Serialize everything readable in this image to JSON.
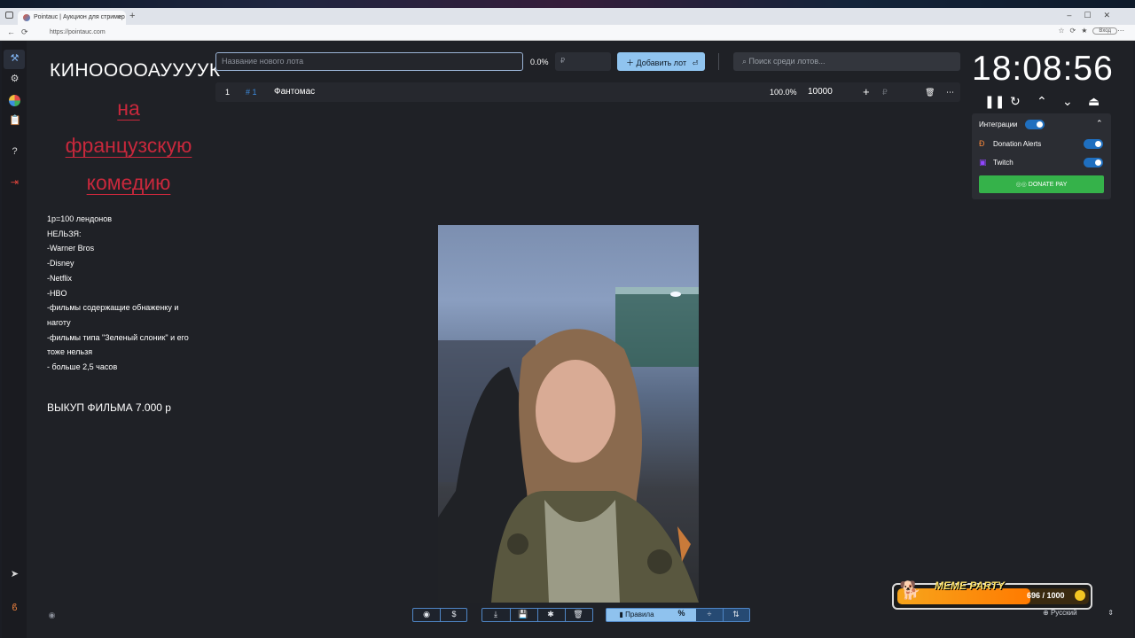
{
  "browser": {
    "tab_title": "Pointauc | Аукцион для стример",
    "url": "https://pointauc.com",
    "login_label": "Вход"
  },
  "left_panel": {
    "title_line1": "КИНООООАУУУУК",
    "title_red": [
      "на",
      "французскую",
      "комедию"
    ],
    "rules": [
      "1р=100 лендонов",
      "НЕЛЬЗЯ:",
      "-Warner Bros",
      "-Disney",
      "-Netflix",
      "-HBO",
      "-фильмы содержащие обнаженку и наготу",
      "-фильмы типа \"Зеленый слоник\" и его тоже нельзя",
      "- больше 2,5 часов"
    ],
    "buyout": "ВЫКУП ФИЛЬМА 7.000 р"
  },
  "toolbar": {
    "new_lot_placeholder": "Название нового лота",
    "percent": "0.0%",
    "amount_placeholder": "₽",
    "add_lot_label": "Добавить лот",
    "search_placeholder": "Поиск среди лотов..."
  },
  "lots": [
    {
      "index": "1",
      "id": "# 1",
      "name": "Фантомас",
      "percent": "100.0%",
      "amount": "10000"
    }
  ],
  "timer": {
    "time": "18:08:56"
  },
  "integrations": {
    "title": "Интеграции",
    "items": [
      {
        "name": "Donation Alerts",
        "enabled": true
      },
      {
        "name": "Twitch",
        "enabled": true
      }
    ],
    "donate_label": "DONATE PAY"
  },
  "bottom_bar": {
    "rules_label": "Правила"
  },
  "overlay": {
    "meme_label": "MEME PARTY",
    "progress_text": "696 / 1000",
    "progress": 0.696
  },
  "language": {
    "label": "Русский"
  },
  "colors": {
    "accent": "#90c4ef",
    "red_title": "#c8283c",
    "donate": "#35b24a"
  }
}
